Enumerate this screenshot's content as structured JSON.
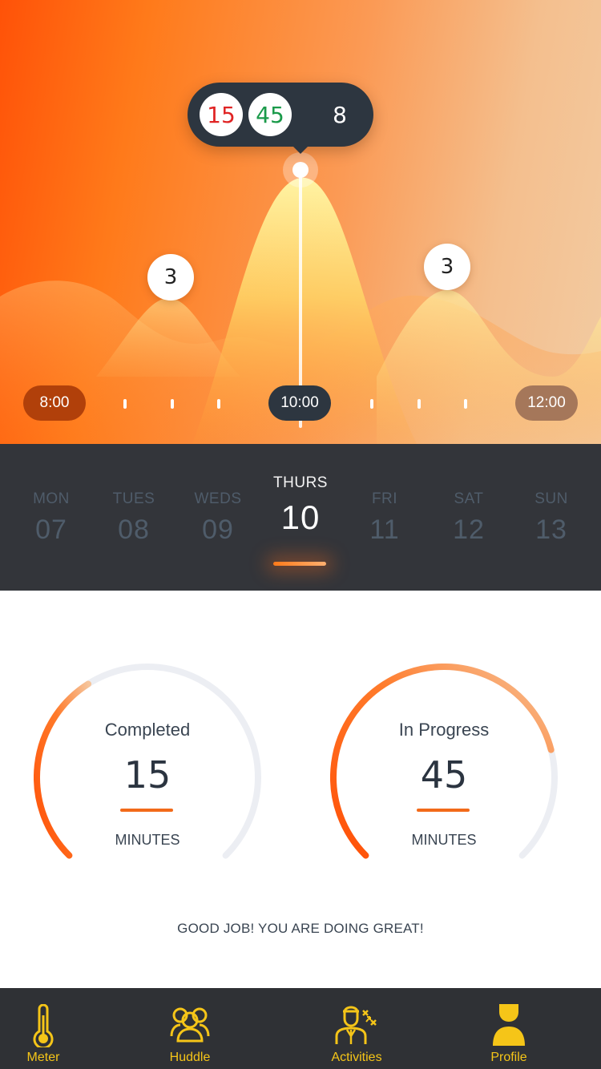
{
  "chart": {
    "tooltip": {
      "completed": "15",
      "in_progress": "45",
      "other": "8"
    },
    "peaks": {
      "left": "3",
      "right": "3"
    },
    "times": {
      "start": "8:00",
      "current": "10:00",
      "end": "12:00"
    }
  },
  "days": [
    {
      "name": "MON",
      "num": "07"
    },
    {
      "name": "TUES",
      "num": "08"
    },
    {
      "name": "WEDS",
      "num": "09"
    },
    {
      "name": "THURS",
      "num": "10"
    },
    {
      "name": "FRI",
      "num": "11"
    },
    {
      "name": "SAT",
      "num": "12"
    },
    {
      "name": "SUN",
      "num": "13"
    }
  ],
  "active_day_index": 3,
  "gauges": [
    {
      "title": "Completed",
      "value": "15",
      "unit": "MINUTES",
      "progress": 0.38
    },
    {
      "title": "In Progress",
      "value": "45",
      "unit": "MINUTES",
      "progress": 0.78
    }
  ],
  "message": "GOOD JOB! YOU ARE DOING GREAT!",
  "tabs": [
    {
      "label": "Meter",
      "icon": "thermometer-icon"
    },
    {
      "label": "Huddle",
      "icon": "group-icon"
    },
    {
      "label": "Activities",
      "icon": "coach-strategy-icon"
    },
    {
      "label": "Profile",
      "icon": "person-icon"
    }
  ],
  "colors": {
    "accent": "#ff5a0a",
    "dark": "#2d3640",
    "tab_active": "#f5c518",
    "completed": "#e02424",
    "in_progress": "#1a9a4a"
  }
}
